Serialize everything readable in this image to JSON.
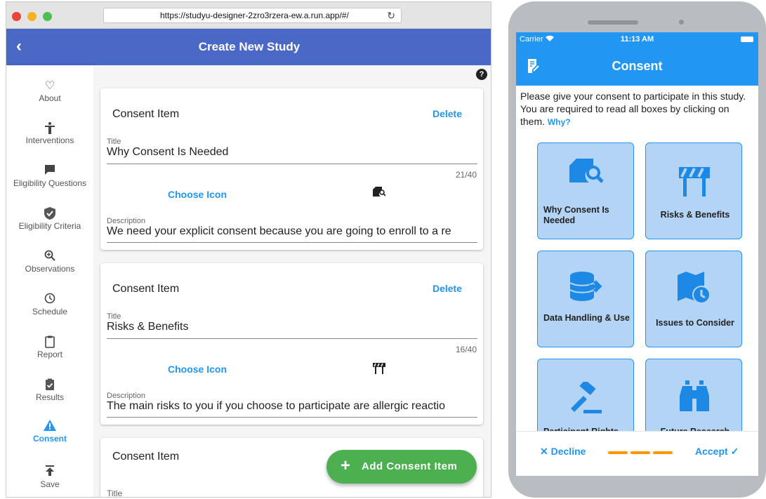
{
  "browser": {
    "url": "https://studyu-designer-2zro3rzera-ew.a.run.app/#/",
    "traffic_light_colors": [
      "#ee4337",
      "#f5b324",
      "#4ac152"
    ],
    "reload_icon": "reload-icon"
  },
  "app_bar": {
    "back_icon": "back-arrow-icon",
    "title": "Create New Study",
    "color": "#4a68c6"
  },
  "sidebar": {
    "items": [
      {
        "label": "About",
        "icon": "heart-icon"
      },
      {
        "label": "Interventions",
        "icon": "person-icon"
      },
      {
        "label": "Eligibility Questions",
        "icon": "chat-icon"
      },
      {
        "label": "Eligibility Criteria",
        "icon": "shield-check-icon"
      },
      {
        "label": "Observations",
        "icon": "zoom-icon"
      },
      {
        "label": "Schedule",
        "icon": "clock-icon"
      },
      {
        "label": "Report",
        "icon": "clipboard-icon"
      },
      {
        "label": "Results",
        "icon": "clipboard-check-icon"
      },
      {
        "label": "Consent",
        "icon": "warning-icon",
        "active": true
      },
      {
        "label": "Save",
        "icon": "upload-icon"
      }
    ],
    "active_color": "#2196f3"
  },
  "consent_items": [
    {
      "header": "Consent Item",
      "delete_label": "Delete",
      "title_label": "Title",
      "title_value": "Why Consent Is Needed",
      "counter": "21/40",
      "choose_icon_label": "Choose Icon",
      "icon": "document-search-icon",
      "description_label": "Description",
      "description_value": "We need your explicit consent because you are going to enroll to a re"
    },
    {
      "header": "Consent Item",
      "delete_label": "Delete",
      "title_label": "Title",
      "title_value": "Risks & Benefits",
      "counter": "16/40",
      "choose_icon_label": "Choose Icon",
      "icon": "roadblock-icon",
      "description_label": "Description",
      "description_value": "The main risks to you if you choose to participate are allergic reactio"
    },
    {
      "header": "Consent Item",
      "title_label": "Title"
    }
  ],
  "help_icon": "help-icon",
  "fab": {
    "label": "Add Consent Item",
    "icon": "plus-icon",
    "color": "#4caf50"
  },
  "phone": {
    "status": {
      "carrier": "Carrier",
      "wifi_icon": "wifi-icon",
      "time": "11:13 AM",
      "battery_icon": "battery-icon"
    },
    "app_bar": {
      "title": "Consent",
      "icon": "document-edit-icon",
      "color": "#2196f3"
    },
    "intro": "Please give your consent to participate in this study. You are required to read all boxes by clicking on them.",
    "why_label": "Why?",
    "tiles": [
      {
        "label": "Why Consent Is Needed",
        "icon": "document-search-icon"
      },
      {
        "label": "Risks & Benefits",
        "icon": "roadblock-icon"
      },
      {
        "label": "Data Handling & Use",
        "icon": "database-export-icon"
      },
      {
        "label": "Issues to Consider",
        "icon": "map-clock-icon"
      },
      {
        "label": "Participant Rights",
        "icon": "gavel-icon"
      },
      {
        "label": "Future Research",
        "icon": "binoculars-icon"
      }
    ],
    "tile_color": "#b3d4f5",
    "decline_label": "Decline",
    "decline_icon": "close-icon",
    "accept_label": "Accept",
    "accept_icon": "check-icon",
    "progress_steps": 3,
    "progress_color": "#ff9800"
  }
}
